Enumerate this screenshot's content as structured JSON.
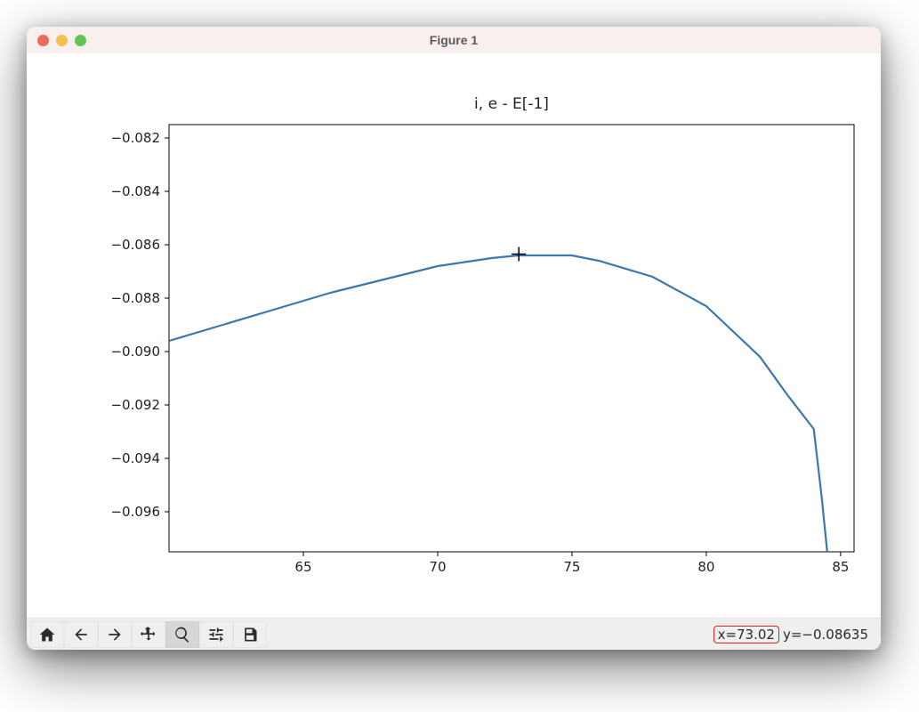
{
  "window": {
    "title": "Figure 1"
  },
  "toolbar": {
    "home": "Home",
    "back": "Back",
    "forward": "Forward",
    "pan": "Pan",
    "zoom": "Zoom",
    "configure": "Configure subplots",
    "save": "Save"
  },
  "coords": {
    "x_label": "x=73.02",
    "y_label": "y=−0.08635"
  },
  "chart_data": {
    "type": "line",
    "title": "i, e - E[-1]",
    "xlabel": "",
    "ylabel": "",
    "xlim": [
      60,
      85.5
    ],
    "ylim": [
      -0.0975,
      -0.0815
    ],
    "x_ticks": [
      65,
      70,
      75,
      80,
      85
    ],
    "y_ticks": [
      -0.082,
      -0.084,
      -0.086,
      -0.088,
      -0.09,
      -0.092,
      -0.094,
      -0.096
    ],
    "y_tick_labels": [
      "−0.082",
      "−0.084",
      "−0.086",
      "−0.088",
      "−0.090",
      "−0.092",
      "−0.094",
      "−0.096"
    ],
    "x_tick_labels": [
      "65",
      "70",
      "75",
      "80",
      "85"
    ],
    "series": [
      {
        "name": "e - E[-1]",
        "color": "#3b77b0",
        "x": [
          60,
          62,
          64,
          66,
          68,
          70,
          72,
          73,
          74,
          75,
          76,
          78,
          80,
          82,
          83,
          84,
          84.3,
          84.5
        ],
        "y": [
          -0.0896,
          -0.089,
          -0.0884,
          -0.0878,
          -0.0873,
          -0.0868,
          -0.0865,
          -0.0864,
          -0.0864,
          -0.0864,
          -0.0866,
          -0.0872,
          -0.0883,
          -0.0902,
          -0.0916,
          -0.0929,
          -0.0955,
          -0.0975
        ]
      }
    ],
    "cursor": {
      "x": 73.02,
      "y": -0.08635
    }
  }
}
